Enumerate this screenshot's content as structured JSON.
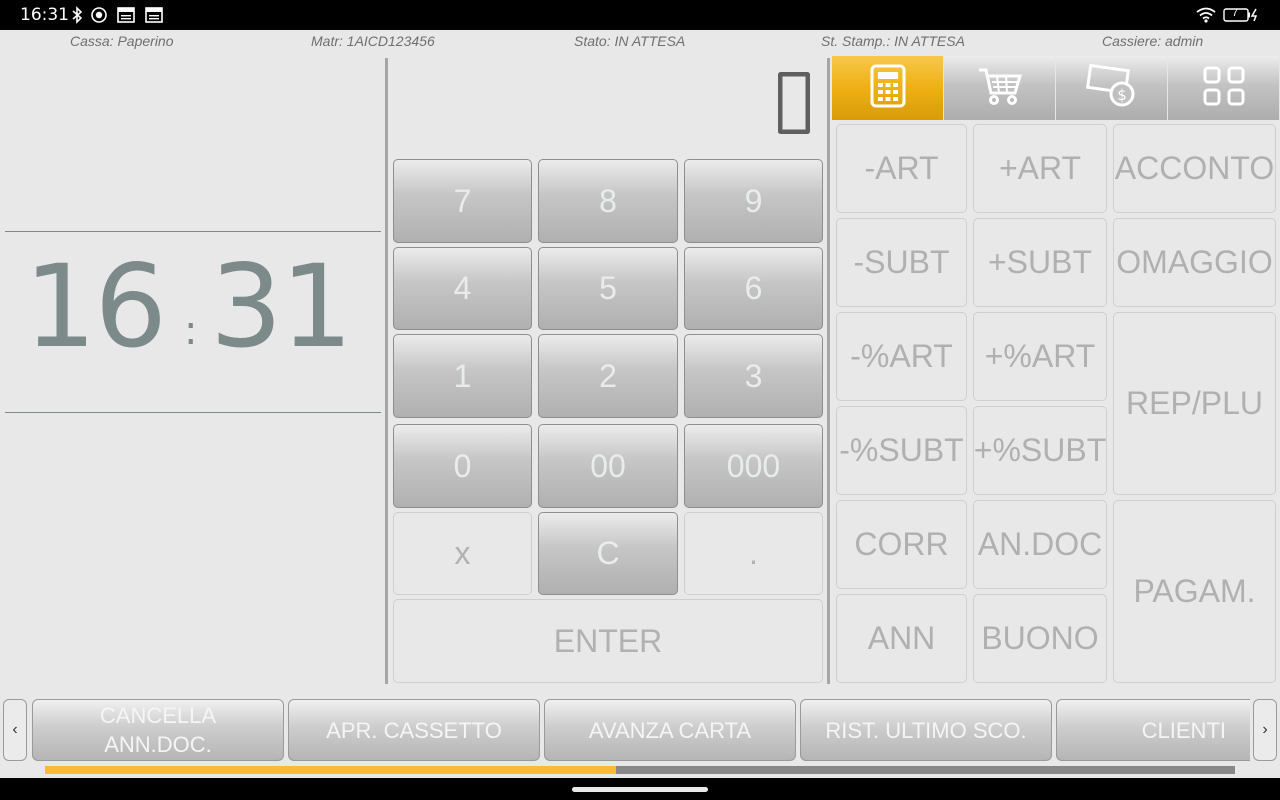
{
  "status_bar": {
    "time": "16:31",
    "icons": [
      "bluetooth-icon",
      "hotspot-icon",
      "calendar-icon",
      "calendar-icon",
      "wifi-icon"
    ],
    "battery": "7"
  },
  "info": {
    "cassa": "Cassa: Paperino",
    "matricola": "Matr: 1AICD123456",
    "stato": "Stato: IN ATTESA",
    "stato_stampante": "St. Stamp.: IN ATTESA",
    "cassiere": "Cassiere: admin"
  },
  "clock": {
    "hours": "16",
    "minutes": "31",
    "separator": ":"
  },
  "keypad": {
    "display": "0",
    "keys": [
      "7",
      "8",
      "9",
      "4",
      "5",
      "6",
      "1",
      "2",
      "3",
      "0",
      "00",
      "000",
      "x",
      "C",
      ".",
      "ENTER"
    ]
  },
  "tabs": [
    {
      "icon": "calculator-icon",
      "active": true
    },
    {
      "icon": "cart-icon",
      "active": false
    },
    {
      "icon": "cash-icon",
      "active": false
    },
    {
      "icon": "grid-icon",
      "active": false
    }
  ],
  "functions": {
    "art_minus": "-ART",
    "art_plus": "+ART",
    "acconto": "ACCONTO",
    "subt_minus": "-SUBT",
    "subt_plus": "+SUBT",
    "omaggio": "OMAGGIO",
    "pct_art_minus": "-%ART",
    "pct_art_plus": "+%ART",
    "rep_plu": "REP/PLU",
    "pct_subt_minus": "-%SUBT",
    "pct_subt_plus": "+%SUBT",
    "corr": "CORR",
    "an_doc": "AN.DOC",
    "pagam": "PAGAM.",
    "ann": "ANN",
    "buono": "BUONO"
  },
  "toolbar": {
    "prev": "‹",
    "next": "›",
    "buttons": [
      {
        "line1": "CANCELLA",
        "line2": "ANN.DOC."
      },
      {
        "line1": "APR. CASSETTO"
      },
      {
        "line1": "AVANZA CARTA"
      },
      {
        "line1": "RIST. ULTIMO SCO."
      },
      {
        "line1": "CLIENTI"
      }
    ],
    "scroll_fraction": 0.48
  },
  "colors": {
    "accent": "#eeb014",
    "clock": "#7d8a8a",
    "background": "#e8e8e8",
    "progress": "#f6bd33"
  }
}
